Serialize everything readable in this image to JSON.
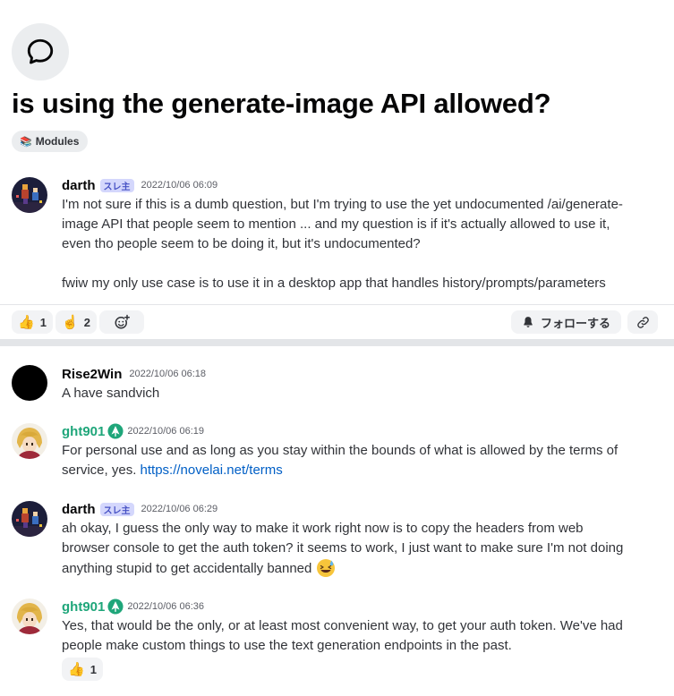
{
  "thread": {
    "title": "is using the generate-image API allowed?",
    "tag": {
      "emoji": "📚",
      "label": "Modules"
    }
  },
  "op_message": {
    "username": "darth",
    "badge": "スレ主",
    "timestamp": "2022/10/06 06:09",
    "lines": [
      "I'm not sure if this is a dumb question, but I'm trying to use the yet undocumented /ai/generate-image API that people seem to mention ... and my question is if it's actually allowed to use it, even tho people seem to be doing it, but it's undocumented?",
      "fwiw my only use case is to use it in a desktop app that handles history/prompts/parameters"
    ]
  },
  "reactions": [
    {
      "emoji": "👍",
      "count": "1"
    },
    {
      "emoji": "☝️",
      "count": "2"
    }
  ],
  "actions": {
    "follow_label": "フォローする"
  },
  "replies": [
    {
      "username": "Rise2Win",
      "timestamp": "2022/10/06 06:18",
      "text": "A have sandvich"
    },
    {
      "username": "ght901",
      "timestamp": "2022/10/06 06:19",
      "text": "For personal use and as long as you stay within the bounds of what is allowed by the terms of service, yes. ",
      "link": "https://novelai.net/terms"
    },
    {
      "username": "darth",
      "badge": "スレ主",
      "timestamp": "2022/10/06 06:29",
      "text": "ah okay, I guess the only way to make it work right now is to copy the headers from web browser console to get the auth token? it seems to work, I just want to make sure I'm not doing anything stupid to get accidentally banned "
    },
    {
      "username": "ght901",
      "timestamp": "2022/10/06 06:36",
      "text": "Yes, that would be the only, or at least most convenient way, to get your auth token. We've had people make custom things to use the text generation endpoints in the past.",
      "reaction": {
        "emoji": "👍",
        "count": "1"
      }
    }
  ],
  "colors": {
    "op_badge_bg": "#d4d7fc",
    "op_badge_text": "#4752c4",
    "moderator_name": "#1fa67a",
    "link": "#005fc6"
  },
  "icons": {
    "thread": "chat-bubble-icon",
    "add_reaction": "add-reaction-icon",
    "follow": "bell-icon",
    "copy_link": "link-icon",
    "role": "leaf-role-icon"
  }
}
